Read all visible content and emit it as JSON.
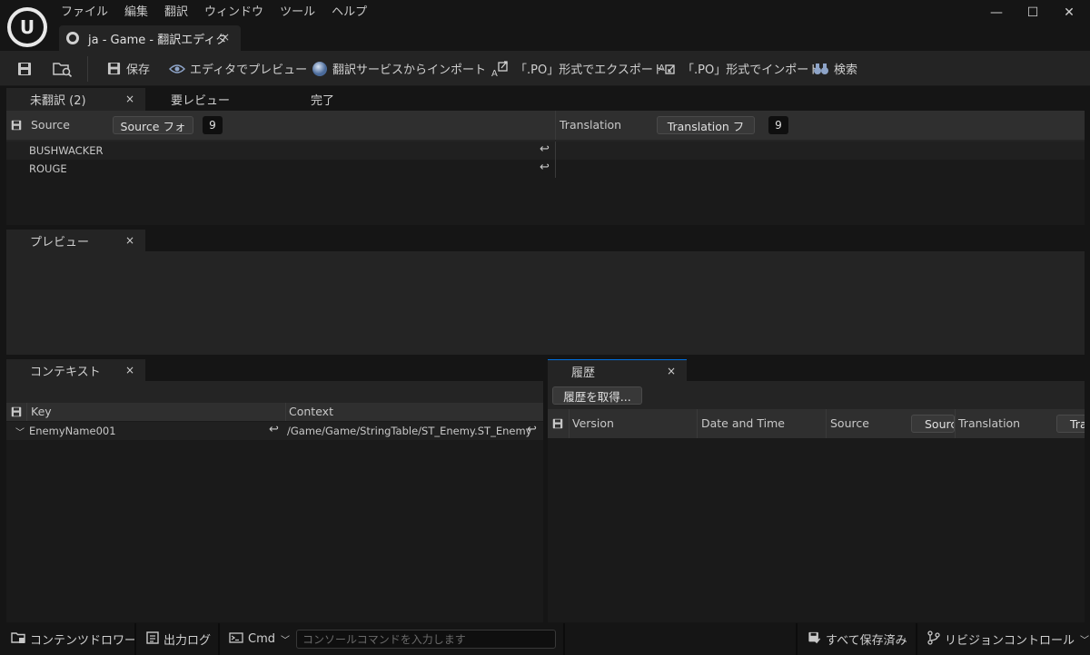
{
  "menu": [
    "ファイル",
    "編集",
    "翻訳",
    "ウィンドウ",
    "ツール",
    "ヘルプ"
  ],
  "window_controls": {
    "minimize": "—",
    "maximize": "☐",
    "close": "✕"
  },
  "document_tab": {
    "label": "ja - Game - 翻訳エディタ",
    "close": "×"
  },
  "toolbar": {
    "save": "保存",
    "preview_in_editor": "エディタでプレビュー",
    "import_from_service": "翻訳サービスからインポート",
    "export_po": "「.PO」形式でエクスポート",
    "import_po": "「.PO」形式でインポート",
    "search": "検索"
  },
  "translation_tabs": [
    {
      "label": "未翻訳 (2)",
      "active": true,
      "close": "×"
    },
    {
      "label": "要レビュー",
      "active": false
    },
    {
      "label": "完了",
      "active": false
    }
  ],
  "translation_header": {
    "source_label": "Source",
    "source_font_button": "Source フォ",
    "source_font_size": "9",
    "translation_label": "Translation",
    "translation_font_button": "Translation フ",
    "translation_font_size": "9"
  },
  "translation_rows": [
    {
      "source": "BUSHWACKER",
      "translation": ""
    },
    {
      "source": "ROUGE",
      "translation": ""
    }
  ],
  "preview_panel": {
    "tab_label": "プレビュー",
    "close": "×"
  },
  "context_panel": {
    "tab_label": "コンテキスト",
    "close": "×",
    "columns": {
      "key": "Key",
      "context": "Context"
    },
    "rows": [
      {
        "key": "EnemyName001",
        "context": "/Game/Game/StringTable/ST_Enemy.ST_Enemy"
      }
    ]
  },
  "history_panel": {
    "tab_label": "履歴",
    "close": "×",
    "get_history_button": "履歴を取得...",
    "columns": {
      "version": "Version",
      "date_time": "Date and Time",
      "source": "Source",
      "source_font_button": "Source",
      "translation": "Translation",
      "translation_font_button": "Tra"
    }
  },
  "statusbar": {
    "content_drawer": "コンテンツドロワー",
    "output_log": "出力ログ",
    "cmd": "Cmd",
    "console_placeholder": "コンソールコマンドを入力します",
    "save_all": "すべて保存済み",
    "revision_control": "リビジョンコントロール"
  },
  "colors": {
    "accent_tab_line": "#0070e0",
    "panel_bg": "#242424",
    "app_bg": "#151515"
  }
}
